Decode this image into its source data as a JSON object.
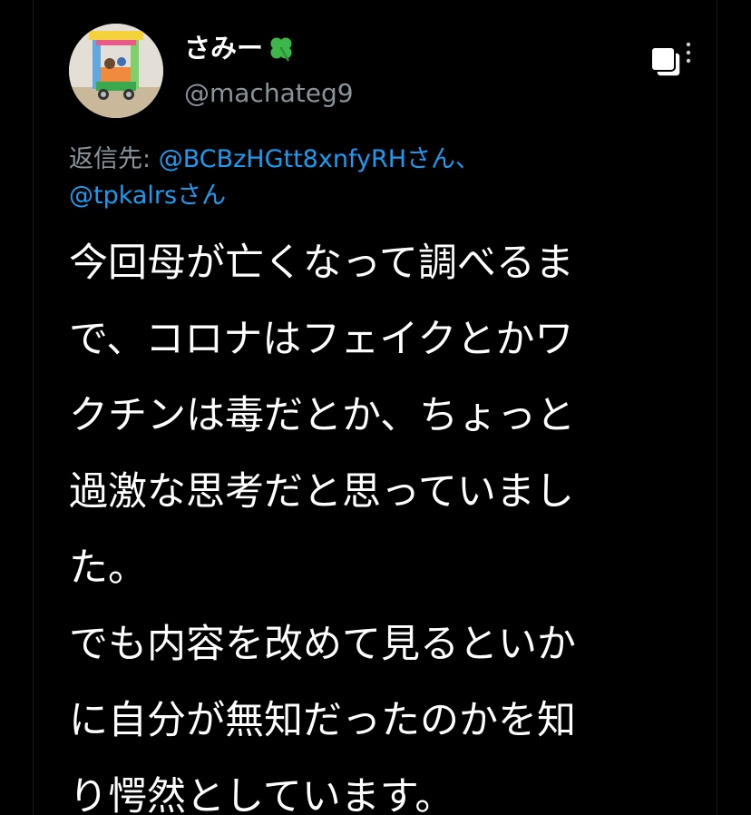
{
  "user": {
    "display_name": "さみー",
    "handle": "@machateg9",
    "avatar_icon": "toy-blocks-avatar",
    "name_emoji": "four-leaf-clover-icon"
  },
  "reply": {
    "prefix": "返信先: ",
    "mention1": "@BCBzHGtt8xnfyRH",
    "suffix1": "さん、",
    "mention2": "@tpkalrs",
    "suffix2": "さん"
  },
  "tweet": {
    "lines": [
      "今回母が亡くなって調べるま",
      "で、コロナはフェイクとかワ",
      "クチンは毒だとか、ちょっと",
      "過激な思考だと思っていまし",
      "た。",
      "でも内容を改めて見るといか",
      "に自分が無知だったのかを知",
      "り愕然としています。"
    ]
  },
  "icons": {
    "copy": "copy-icon",
    "more": "more-vertical-icon"
  },
  "colors": {
    "background": "#000000",
    "text": "#ffffff",
    "secondary": "#8b949b",
    "link": "#1d9bf0",
    "clover": "#3cb84a"
  }
}
